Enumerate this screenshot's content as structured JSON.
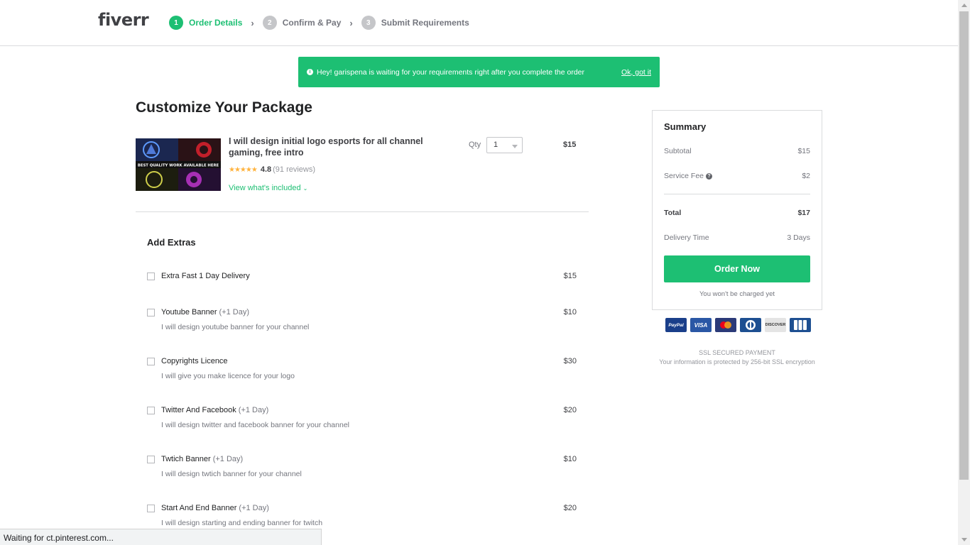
{
  "header": {
    "logo": "fiverr",
    "steps": [
      {
        "num": "1",
        "label": "Order Details",
        "active": true
      },
      {
        "num": "2",
        "label": "Confirm & Pay",
        "active": false
      },
      {
        "num": "3",
        "label": "Submit Requirements",
        "active": false
      }
    ]
  },
  "notice": {
    "text": "Hey! garispena is waiting for your requirements right after you complete the order",
    "dismiss": "Ok, got it"
  },
  "page_title": "Customize Your Package",
  "gig": {
    "title": "I will design initial logo esports for all channel gaming, free intro",
    "stars": "★★★★★",
    "rating": "4.8",
    "reviews": "(91 reviews)",
    "view_included": "View what's included",
    "qty_label": "Qty",
    "qty_value": "1",
    "price": "$15",
    "thumb_banner": "BEST QUALITY WORK AVAILABLE HERE"
  },
  "extras": {
    "title": "Add Extras",
    "items": [
      {
        "name": "Extra Fast 1 Day Delivery",
        "days": "",
        "desc": "",
        "price": "$15"
      },
      {
        "name": "Youtube Banner",
        "days": "(+1 Day)",
        "desc": "I will design youtube banner for your channel",
        "price": "$10"
      },
      {
        "name": "Copyrights Licence",
        "days": "",
        "desc": "I will give you make licence for your logo",
        "price": "$30"
      },
      {
        "name": "Twitter And Facebook",
        "days": "(+1 Day)",
        "desc": "I will design twitter and facebook banner for your channel",
        "price": "$20"
      },
      {
        "name": "Twtich Banner",
        "days": "(+1 Day)",
        "desc": "I will design twtich banner for your channel",
        "price": "$10"
      },
      {
        "name": "Start And End Banner",
        "days": "(+1 Day)",
        "desc": "I will design starting and ending banner for twitch",
        "price": "$20"
      }
    ]
  },
  "summary": {
    "title": "Summary",
    "subtotal_label": "Subtotal",
    "subtotal_value": "$15",
    "fee_label": "Service Fee",
    "fee_value": "$2",
    "total_label": "Total",
    "total_value": "$17",
    "delivery_label": "Delivery Time",
    "delivery_value": "3 Days",
    "order_button": "Order Now",
    "not_charged": "You won't be charged yet"
  },
  "payments": {
    "paypal": "PayPal",
    "visa": "VISA",
    "discover": "DISCOVER"
  },
  "ssl": {
    "title": "SSL SECURED PAYMENT",
    "desc": "Your information is protected by 256-bit SSL encryption"
  },
  "status_bar": "Waiting for ct.pinterest.com...",
  "colors": {
    "brand_green": "#1dbf73",
    "text": "#404145",
    "muted": "#74767e"
  }
}
